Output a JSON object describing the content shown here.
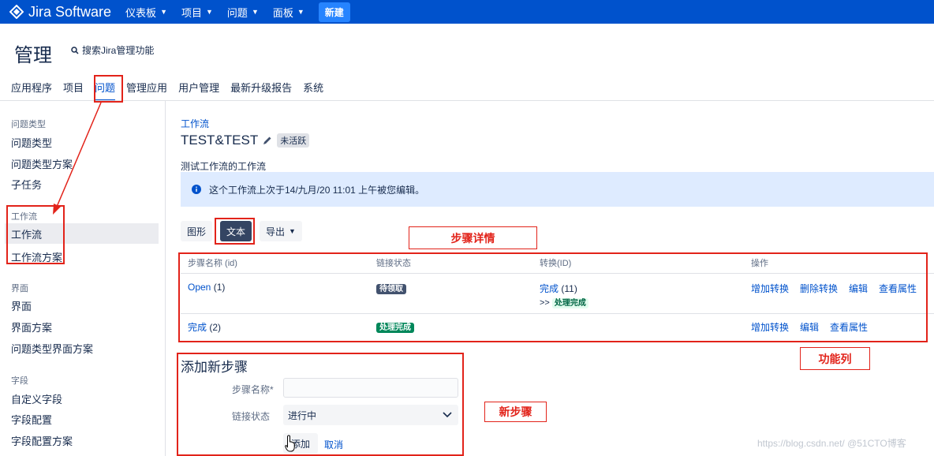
{
  "topnav": {
    "logo_text": "Jira Software",
    "items": [
      {
        "label": "仪表板"
      },
      {
        "label": "项目"
      },
      {
        "label": "问题"
      },
      {
        "label": "面板"
      }
    ],
    "create_label": "新建"
  },
  "header": {
    "title": "管理",
    "search_label": "搜索Jira管理功能"
  },
  "tabs": [
    "应用程序",
    "项目",
    "问题",
    "管理应用",
    "用户管理",
    "最新升级报告",
    "系统"
  ],
  "active_tab": "问题",
  "sidebar": {
    "sections": [
      {
        "heading": "问题类型",
        "items": [
          "问题类型",
          "问题类型方案",
          "子任务"
        ]
      },
      {
        "heading": "工作流",
        "items": [
          "工作流",
          "工作流方案"
        ]
      },
      {
        "heading": "界面",
        "items": [
          "界面",
          "界面方案",
          "问题类型界面方案"
        ]
      },
      {
        "heading": "字段",
        "items": [
          "自定义字段",
          "字段配置",
          "字段配置方案"
        ]
      }
    ],
    "active_item": "工作流"
  },
  "main": {
    "breadcrumb": "工作流",
    "workflow_name": "TEST&TEST",
    "status_lozenge": "未活跃",
    "description": "测试工作流的工作流",
    "info_message": "这个工作流上次于14/九月/20 11:01 上午被您编辑。",
    "view_buttons": [
      "图形",
      "文本"
    ],
    "active_view": "文本",
    "export_label": "导出"
  },
  "table": {
    "headers": [
      "步骤名称 (id)",
      "链接状态",
      "转换(ID)",
      "操作"
    ],
    "rows": [
      {
        "step_name": "Open",
        "step_id": "(1)",
        "status": "待领取",
        "transition": "完成",
        "transition_id": "(11)",
        "transition_arrow": ">>",
        "transition_target": "处理完成",
        "operations": [
          "增加转换",
          "删除转换",
          "编辑",
          "查看属性"
        ]
      },
      {
        "step_name": "完成",
        "step_id": "(2)",
        "status": "处理完成",
        "transition": "",
        "transition_id": "",
        "transition_arrow": "",
        "transition_target": "",
        "operations": [
          "增加转换",
          "编辑",
          "查看属性"
        ]
      }
    ]
  },
  "add_step": {
    "title": "添加新步骤",
    "name_label": "步骤名称*",
    "name_value": "",
    "status_label": "链接状态",
    "status_value": "进行中",
    "add_label": "添加",
    "cancel_label": "取消"
  },
  "annotations": {
    "step_details": "步骤详情",
    "function_column": "功能列",
    "new_step": "新步骤"
  },
  "watermark": "https://blog.csdn.net/ @51CTO博客",
  "colors": {
    "topnav_bg": "#0052cc",
    "annotation_red": "#e2231a",
    "link_blue": "#0052cc"
  }
}
